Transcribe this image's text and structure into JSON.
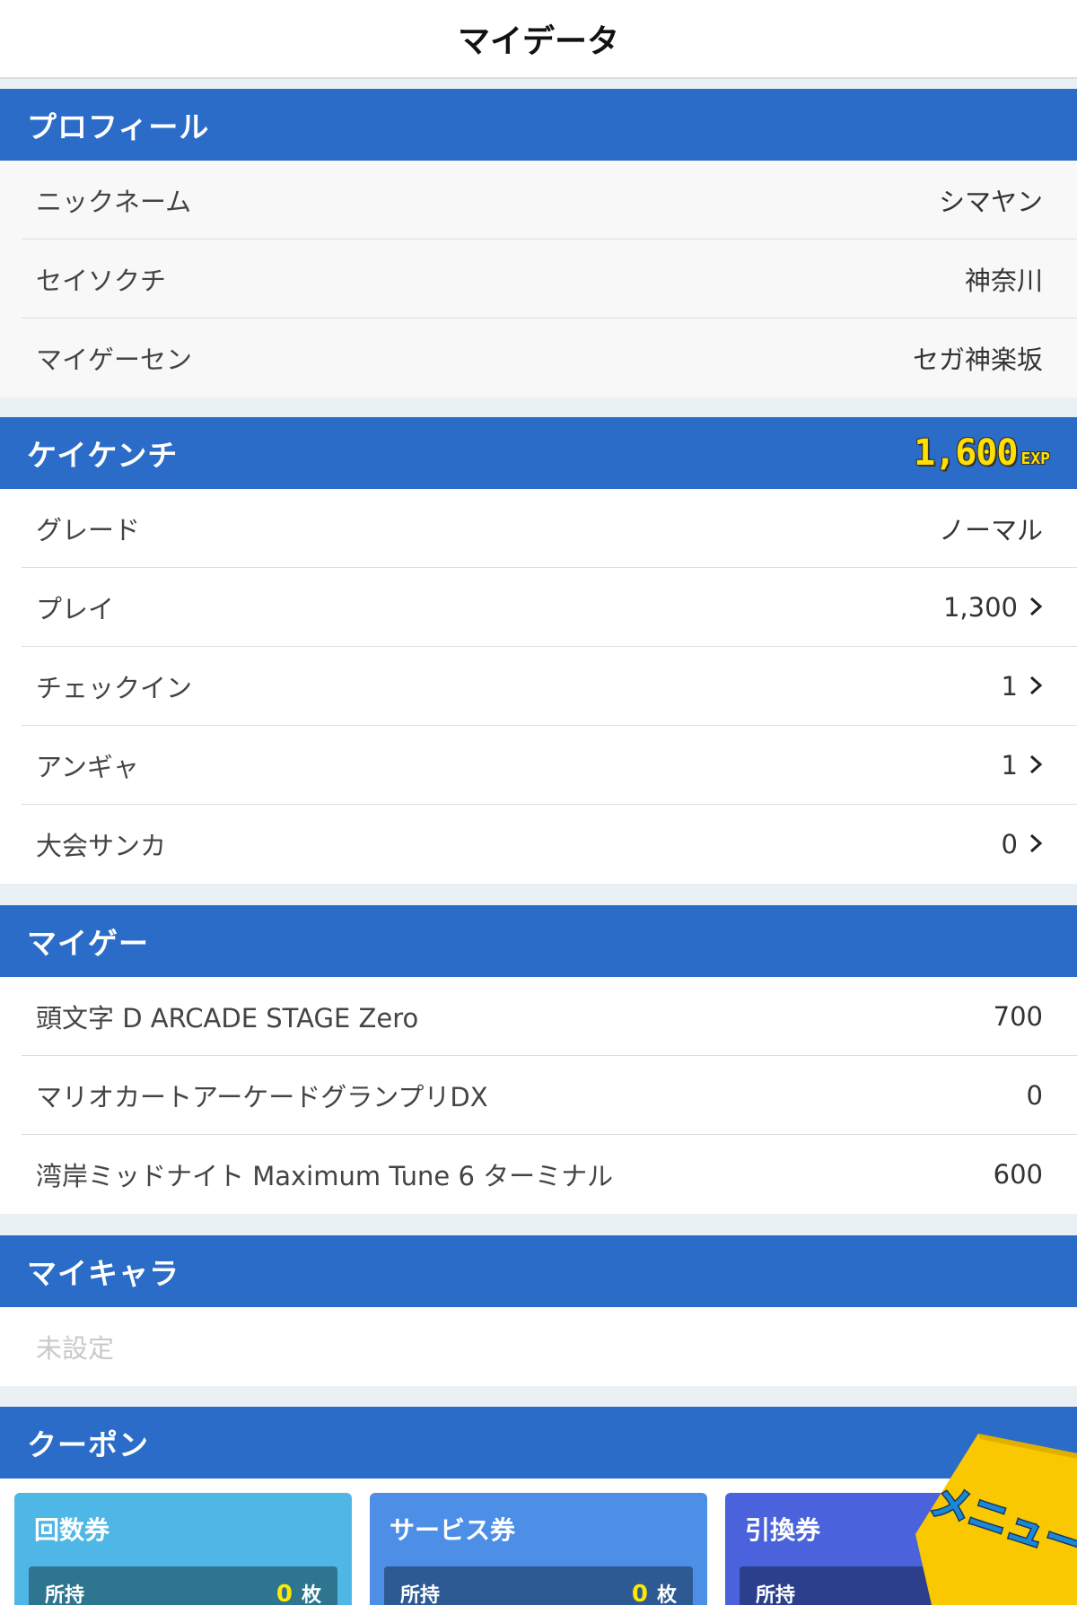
{
  "header": {
    "title": "マイデータ"
  },
  "profile": {
    "title": "プロフィール",
    "rows": [
      {
        "label": "ニックネーム",
        "value": "シマヤン"
      },
      {
        "label": "セイソクチ",
        "value": "神奈川"
      },
      {
        "label": "マイゲーセン",
        "value": "セガ神楽坂"
      }
    ]
  },
  "experience": {
    "title": "ケイケンチ",
    "exp_value": "1,600",
    "exp_unit": "EXP",
    "rows": [
      {
        "label": "グレード",
        "value": "ノーマル"
      },
      {
        "label": "プレイ",
        "value": "1,300"
      },
      {
        "label": "チェックイン",
        "value": "1"
      },
      {
        "label": "アンギャ",
        "value": "1"
      },
      {
        "label": "大会サンカ",
        "value": "0"
      }
    ]
  },
  "mygame": {
    "title": "マイゲー",
    "rows": [
      {
        "label": "頭文字 D ARCADE STAGE Zero",
        "value": "700"
      },
      {
        "label": "マリオカートアーケードグランプリDX",
        "value": "0"
      },
      {
        "label": "湾岸ミッドナイト Maximum Tune 6 ターミナル",
        "value": "600"
      }
    ]
  },
  "mychara": {
    "title": "マイキャラ",
    "unset_text": "未設定"
  },
  "coupon": {
    "title": "クーポン",
    "cards": [
      {
        "title": "回数券",
        "held_label": "所持",
        "count": "0",
        "unit": "枚"
      },
      {
        "title": "サービス券",
        "held_label": "所持",
        "count": "0",
        "unit": "枚"
      },
      {
        "title": "引換券",
        "held_label": "所持",
        "count": "",
        "unit": ""
      }
    ]
  },
  "menu_button": {
    "label": "メニュー"
  },
  "colors": {
    "section_header": "#2a6cc8",
    "exp_yellow": "#ffe000",
    "menu_yellow": "#f9c800",
    "menu_text": "#1c87d6",
    "coupon_1": "#4eb7e6",
    "coupon_2": "#4d8fe6",
    "coupon_3": "#4a63dc"
  },
  "icons": {
    "row_chevron": "chevron-right-icon"
  }
}
